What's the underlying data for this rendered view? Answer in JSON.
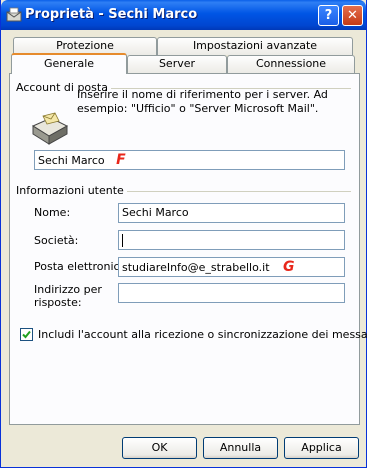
{
  "window": {
    "title": "Proprietà - Sechi Marco",
    "help_button": "?",
    "close_button": "✕"
  },
  "tabs": {
    "row_back": [
      "Protezione",
      "Impostazioni avanzate"
    ],
    "row_front": [
      "Generale",
      "Server",
      "Connessione"
    ],
    "active": "Generale"
  },
  "account": {
    "group_label": "Account di posta",
    "description": "Inserire il nome di riferimento per i server. Ad esempio: \"Ufficio\" o \"Server Microsoft Mail\".",
    "name_value": "Sechi Marco",
    "marker": "F"
  },
  "user_info": {
    "group_label": "Informazioni utente",
    "name_label": "Nome:",
    "name_value": "Sechi Marco",
    "company_label": "Società:",
    "company_value": "",
    "email_label": "Posta elettronica:",
    "email_value": "studiareInfo@e_strabello.it",
    "email_marker": "G",
    "reply_label": "Indirizzo per risposte:",
    "reply_value": ""
  },
  "include_checkbox": {
    "label": "Includi l'account alla ricezione o sincronizzazione dei messaggi",
    "checked": true
  },
  "buttons": {
    "ok": "OK",
    "cancel": "Annulla",
    "apply": "Applica"
  }
}
